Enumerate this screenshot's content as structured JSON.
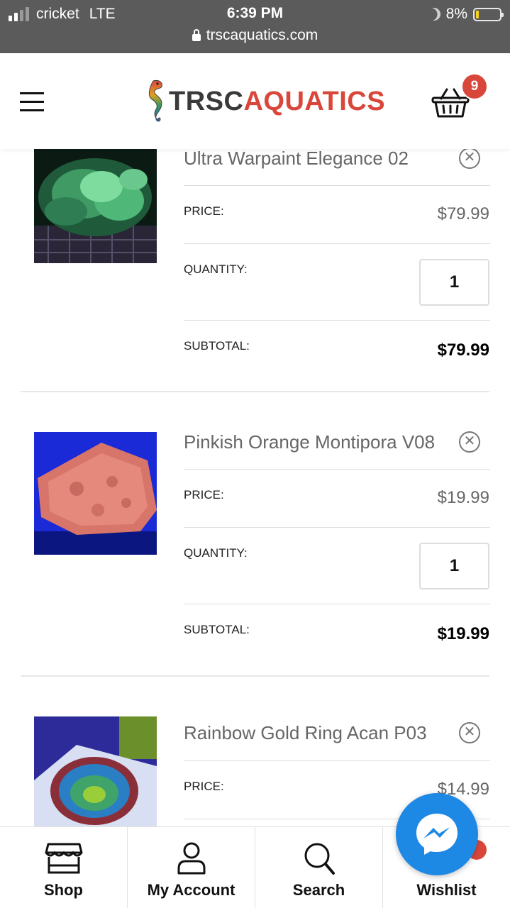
{
  "status_bar": {
    "carrier": "cricket",
    "network": "LTE",
    "time": "6:39 PM",
    "battery": "8%",
    "battery_level": 0.08
  },
  "browser": {
    "url": "trscaquatics.com"
  },
  "header": {
    "logo_left": "TRSC",
    "logo_right": "AQUATICS",
    "cart_count": "9",
    "colors": {
      "accent": "#d9473b",
      "logo_dark": "#3a3a3a"
    }
  },
  "cart": {
    "items": [
      {
        "name": "Ultra Warpaint Elegance 02",
        "price_label": "PRICE:",
        "price": "$79.99",
        "quantity_label": "QUANTITY:",
        "quantity": "1",
        "subtotal_label": "SUBTOTAL:",
        "subtotal": "$79.99",
        "remove_icon": "close-circle-icon"
      },
      {
        "name": "Pinkish Orange Montipora V08",
        "price_label": "PRICE:",
        "price": "$19.99",
        "quantity_label": "QUANTITY:",
        "quantity": "1",
        "subtotal_label": "SUBTOTAL:",
        "subtotal": "$19.99",
        "remove_icon": "close-circle-icon"
      },
      {
        "name": "Rainbow Gold Ring Acan P03",
        "price_label": "PRICE:",
        "price": "$14.99",
        "remove_icon": "close-circle-icon"
      }
    ]
  },
  "bottom_nav": {
    "items": [
      {
        "label": "Shop",
        "icon": "storefront-icon"
      },
      {
        "label": "My Account",
        "icon": "user-icon"
      },
      {
        "label": "Search",
        "icon": "search-icon"
      },
      {
        "label": "Wishlist",
        "icon": "heart-icon"
      }
    ]
  },
  "messenger": {
    "icon": "messenger-icon",
    "color": "#1e88e5"
  }
}
